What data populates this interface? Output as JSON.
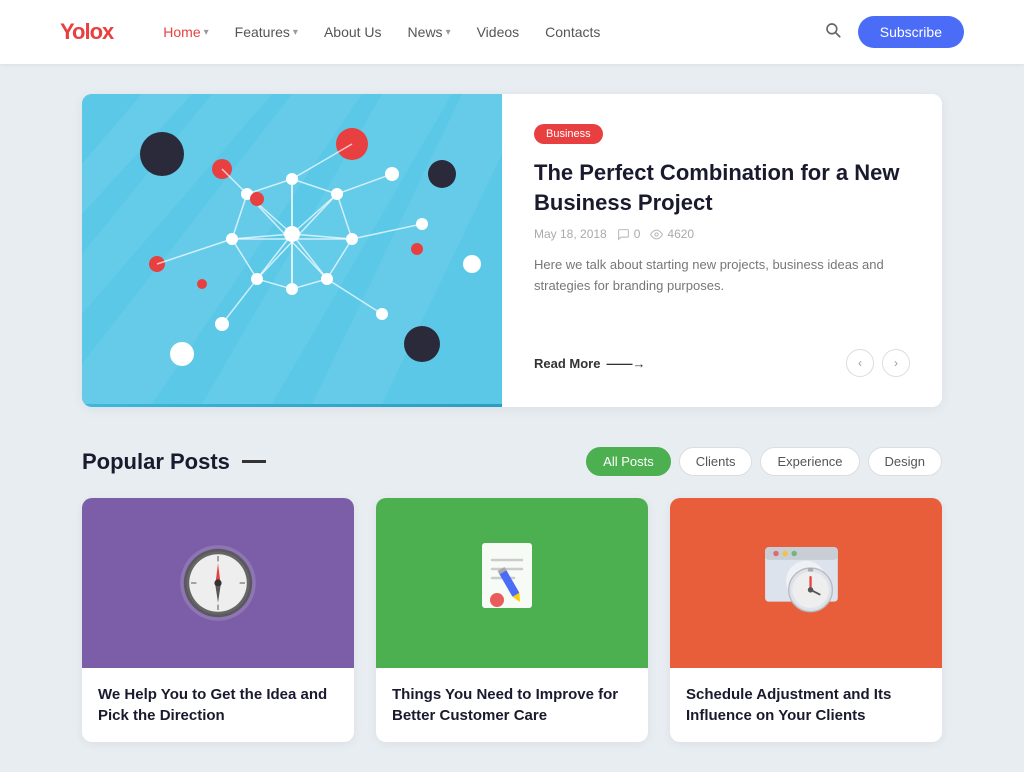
{
  "brand": {
    "name_part1": "Yolo",
    "name_part2": "x"
  },
  "nav": {
    "items": [
      {
        "label": "Home",
        "active": true,
        "hasDropdown": true
      },
      {
        "label": "Features",
        "active": false,
        "hasDropdown": true
      },
      {
        "label": "About Us",
        "active": false,
        "hasDropdown": false
      },
      {
        "label": "News",
        "active": false,
        "hasDropdown": true
      },
      {
        "label": "Videos",
        "active": false,
        "hasDropdown": false
      },
      {
        "label": "Contacts",
        "active": false,
        "hasDropdown": false
      }
    ],
    "subscribe_label": "Subscribe"
  },
  "hero": {
    "badge": "Business",
    "title": "The Perfect Combination for a New Business Project",
    "date": "May 18, 2018",
    "comments": "0",
    "views": "4620",
    "description": "Here we talk about starting new projects, business ideas and strategies for branding purposes.",
    "read_more": "Read More",
    "arrow": "→"
  },
  "popular_posts": {
    "section_title": "Popular Posts",
    "filters": [
      {
        "label": "All Posts",
        "active": true
      },
      {
        "label": "Clients",
        "active": false
      },
      {
        "label": "Experience",
        "active": false
      },
      {
        "label": "Design",
        "active": false
      }
    ],
    "posts": [
      {
        "color": "purple",
        "title": "We Help You to Get the Idea and Pick the Direction",
        "icon": "compass"
      },
      {
        "color": "green",
        "title": "Things You Need to Improve for Better Customer Care",
        "icon": "document"
      },
      {
        "color": "orange",
        "title": "Schedule Adjustment and Its Influence on Your Clients",
        "icon": "clock"
      }
    ]
  }
}
